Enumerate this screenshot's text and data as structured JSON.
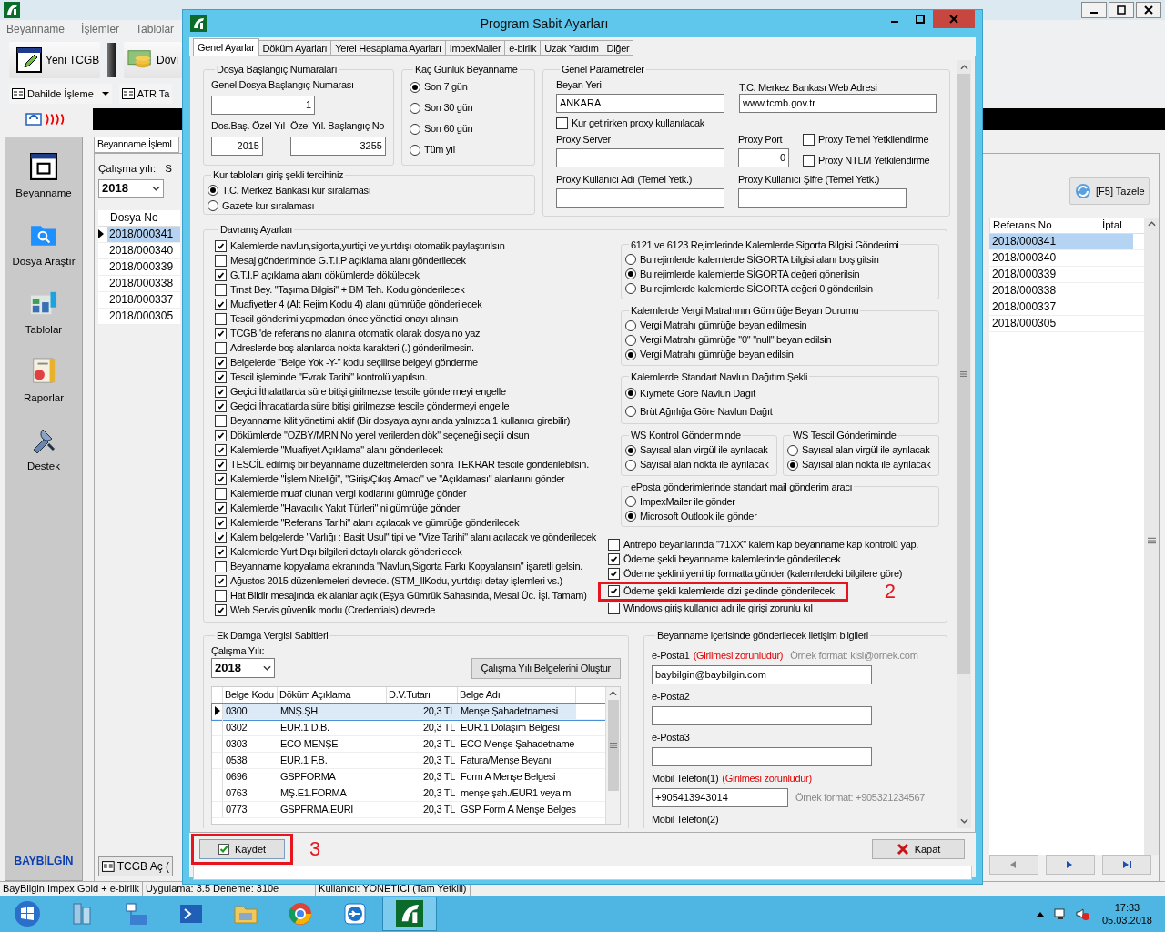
{
  "app": {
    "menu": [
      "Beyanname",
      "İşlemler",
      "Tablolar"
    ],
    "toolbar": [
      "Yeni TCGB",
      "Dövi"
    ],
    "toolbar2": [
      {
        "label": "Dahilde İşleme",
        "kind": "dropdown"
      },
      {
        "label": "ATR Ta",
        "kind": "plain"
      }
    ],
    "sidebar": [
      {
        "label": "Beyanname",
        "kind": "form"
      },
      {
        "label": "Dosya Araştır",
        "kind": "folder"
      },
      {
        "label": "Tablolar",
        "kind": "chart"
      },
      {
        "label": "Raporlar",
        "kind": "report"
      },
      {
        "label": "Destek",
        "kind": "tools"
      }
    ],
    "brand": "BAYBİLGİN",
    "tab": "Beyanname İşleml",
    "year_label": "Çalışma yılı:",
    "year_label_2": "S",
    "year": "2018",
    "grid": {
      "columns": [
        "Dosya No"
      ],
      "rows": [
        {
          "value": "2018/000341",
          "selected": true
        },
        {
          "value": "2018/000340",
          "selected": false
        },
        {
          "value": "2018/000339",
          "selected": false
        },
        {
          "value": "2018/000338",
          "selected": false
        },
        {
          "value": "2018/000337",
          "selected": false
        },
        {
          "value": "2018/000305",
          "selected": false
        }
      ]
    },
    "refresh_button": "[F5] Tazele",
    "right_grid": {
      "columns": [
        "Referans No",
        "İptal"
      ],
      "rows": [
        {
          "value": "2018/000341",
          "selected": true
        },
        {
          "value": "2018/000340",
          "selected": false
        },
        {
          "value": "2018/000339",
          "selected": false
        },
        {
          "value": "2018/000338",
          "selected": false
        },
        {
          "value": "2018/000337",
          "selected": false
        },
        {
          "value": "2018/000305",
          "selected": false
        }
      ]
    },
    "open_button": "TCGB Aç (",
    "status_bar": [
      "BayBilgin Impex Gold + e-birlik",
      "Uygulama: 3.5 Deneme: 310e",
      "Kullanıcı: YÖNETİCİ (Tam Yetkili)"
    ]
  },
  "dialog": {
    "title": "Program Sabit Ayarları",
    "tabs": [
      {
        "label": "Genel Ayarlar",
        "selected": true
      },
      {
        "label": "Döküm Ayarları",
        "selected": false
      },
      {
        "label": "Yerel Hesaplama Ayarları",
        "selected": false
      },
      {
        "label": "ImpexMailer",
        "selected": false
      },
      {
        "label": "e-birlik",
        "selected": false
      },
      {
        "label": "Uzak Yardım",
        "selected": false
      },
      {
        "label": "Diğer",
        "selected": false
      }
    ],
    "file_numbers": {
      "title": "Dosya Başlangıç Numaraları",
      "general_label": "Genel Dosya Başlangıç Numarası",
      "general_value": "1",
      "year_label": "Dos.Baş. Özel Yıl",
      "year_value": "2015",
      "start_label": "Özel Yıl. Başlangıç No",
      "start_value": "3255"
    },
    "days": {
      "title": "Kaç Günlük Beyanname",
      "options": [
        {
          "label": "Son 7 gün",
          "selected": true
        },
        {
          "label": "Son 30 gün",
          "selected": false
        },
        {
          "label": "Son 60 gün",
          "selected": false
        },
        {
          "label": "Tüm yıl",
          "selected": false
        }
      ]
    },
    "rate_table": {
      "title": "Kur tabloları giriş şekli tercihiniz",
      "options": [
        {
          "label": "T.C. Merkez Bankası kur sıralaması",
          "selected": true
        },
        {
          "label": "Gazete kur sıralaması",
          "selected": false
        }
      ]
    },
    "general": {
      "title": "Genel Parametreler",
      "place_label": "Beyan Yeri",
      "place_value": "ANKARA",
      "bank_label": "T.C. Merkez Bankası Web Adresi",
      "bank_value": "www.tcmb.gov.tr",
      "use_proxy": {
        "label": "Kur getirirken proxy kullanılacak",
        "checked": false
      },
      "server_label": "Proxy Server",
      "port_label": "Proxy Port",
      "port_value": "0",
      "auth": [
        {
          "label": "Proxy Temel Yetkilendirme",
          "checked": false
        },
        {
          "label": "Proxy NTLM Yetkilendirme",
          "checked": false
        }
      ],
      "user_label": "Proxy Kullanıcı Adı (Temel Yetk.)",
      "password_label": "Proxy Kullanıcı Şifre (Temel Yetk.)"
    },
    "behavior": {
      "title": "Davranış Ayarları",
      "options": [
        {
          "label": "Kalemlerde navlun,sigorta,yurtiçi ve yurtdışı otomatik paylaştırılsın",
          "checked": true
        },
        {
          "label": "Mesaj gönderiminde G.T.I.P açıklama alanı gönderilecek",
          "checked": false
        },
        {
          "label": "G.T.I.P açıklama alanı dökümlerde dökülecek",
          "checked": true
        },
        {
          "label": "Trnst Bey. \"Taşıma Bilgisi\" + BM Teh. Kodu gönderilecek",
          "checked": false
        },
        {
          "label": "Muafiyetler 4 (Alt Rejim Kodu 4) alanı gümrüğe gönderilecek",
          "checked": true
        },
        {
          "label": "Tescil gönderimi yapmadan önce yönetici onayı alınsın",
          "checked": false
        },
        {
          "label": "TCGB 'de referans no alanına otomatik olarak dosya no yaz",
          "checked": true
        },
        {
          "label": "Adreslerde boş alanlarda nokta karakteri (.) gönderilmesin.",
          "checked": false
        },
        {
          "label": "Belgelerde \"Belge Yok -Y-\" kodu seçilirse belgeyi gönderme",
          "checked": true
        },
        {
          "label": "Tescil işleminde \"Evrak Tarihi\" kontrolü yapılsın.",
          "checked": true
        },
        {
          "label": "Geçici İthalatlarda süre bitişi girilmezse tescile göndermeyi engelle",
          "checked": true
        },
        {
          "label": "Geçici İhracatlarda süre bitişi girilmezse tescile göndermeyi engelle",
          "checked": true
        },
        {
          "label": "Beyanname kilit yönetimi aktif (Bir dosyaya aynı anda yalnızca 1 kullanıcı girebilir)",
          "checked": false
        },
        {
          "label": "Dökümlerde \"ÖZBY/MRN No yerel verilerden dök\" seçeneği  seçili olsun",
          "checked": true
        },
        {
          "label": "Kalemlerde \"Muafiyet Açıklama\" alanı gönderilecek",
          "checked": true
        },
        {
          "label": "TESCİL edilmiş bir beyanname düzeltmelerden sonra TEKRAR tescile gönderilebilsin.",
          "checked": true
        },
        {
          "label": "Kalemlerde \"İşlem Niteliği\", \"Giriş/Çıkış Amacı\" ve \"Açıklaması\" alanlarını gönder",
          "checked": true
        },
        {
          "label": "Kalemlerde muaf olunan vergi kodlarını gümrüğe gönder",
          "checked": false
        },
        {
          "label": "Kalemlerde \"Havacılık Yakıt Türleri\" ni gümrüğe gönder",
          "checked": true
        },
        {
          "label": "Kalemlerde \"Referans Tarihi\" alanı açılacak ve gümrüğe gönderilecek",
          "checked": true
        },
        {
          "label": "Kalem belgelerde \"Varlığı : Basit Usul\" tipi ve \"Vize Tarihi\" alanı açılacak ve gönderilecek",
          "checked": true
        },
        {
          "label": "Kalemlerde Yurt Dışı bilgileri detaylı olarak gönderilecek",
          "checked": true
        },
        {
          "label": "Beyanname kopyalama ekranında \"Navlun,Sigorta Farkı Kopyalansın\" işaretli gelsin.",
          "checked": false
        },
        {
          "label": "Ağustos 2015 düzenlemeleri devrede. (STM_IlKodu, yurtdışı detay işlemleri vs.)",
          "checked": true
        },
        {
          "label": "Hat Bildir mesajında ek alanlar açık (Eşya Gümrük Sahasında, Mesai Üc. İşl. Tamam)",
          "checked": false
        },
        {
          "label": "Web Servis güvenlik modu (Credentials) devrede",
          "checked": true
        }
      ],
      "groups": [
        {
          "kind": "full",
          "title": "6121 ve 6123 Rejimlerinde Kalemlerde Sigorta Bilgisi Gönderimi",
          "options": [
            {
              "label": "Bu rejimlerde kalemlerde SİGORTA bilgisi alanı boş gitsin",
              "selected": false
            },
            {
              "label": "Bu rejimlerde kalemlerde SİGORTA değeri gönerilsin",
              "selected": true
            },
            {
              "label": "Bu rejimlerde kalemlerde SİGORTA değeri 0 gönderilsin",
              "selected": false
            }
          ]
        },
        {
          "kind": "full",
          "title": "Kalemlerde Vergi Matrahının Gümrüğe Beyan Durumu",
          "options": [
            {
              "label": "Vergi Matrahı gümrüğe beyan edilmesin",
              "selected": false
            },
            {
              "label": "Vergi Matrahı gümrüğe \"0\" \"null\" beyan edilsin",
              "selected": false
            },
            {
              "label": "Vergi Matrahı gümrüğe beyan edilsin",
              "selected": true
            }
          ]
        },
        {
          "kind": "full",
          "title": "Kalemlerde Standart Navlun Dağıtım Şekli",
          "options": [
            {
              "label": "Kıymete Göre Navlun Dağıt",
              "selected": true
            },
            {
              "label": "Brüt Ağırlığa Göre Navlun Dağıt",
              "selected": false
            }
          ]
        },
        {
          "kind": "half",
          "title": "WS Kontrol Gönderiminde",
          "options": [
            {
              "label": "Sayısal alan virgül ile ayrılacak",
              "selected": true
            },
            {
              "label": "Sayısal alan nokta ile ayrılacak",
              "selected": false
            }
          ]
        },
        {
          "kind": "half",
          "title": "WS Tescil Gönderiminde",
          "options": [
            {
              "label": "Sayısal alan virgül ile ayrılacak",
              "selected": false
            },
            {
              "label": "Sayısal alan nokta ile ayrılacak",
              "selected": true
            }
          ]
        },
        {
          "kind": "full",
          "title": "ePosta gönderimlerinde standart mail gönderim aracı",
          "options": [
            {
              "label": "ImpexMailer ile gönder",
              "selected": false
            },
            {
              "label": "Microsoft Outlook ile gönder",
              "selected": true
            }
          ]
        }
      ],
      "extra_options": [
        {
          "label": "Antrepo beyanlarında \"71XX\" kalem kap beyanname kap kontrolü yap.",
          "checked": false
        },
        {
          "label": "Ödeme şekli beyanname kalemlerinde gönderilecek",
          "checked": true
        },
        {
          "label": "Ödeme şeklini yeni tip formatta gönder (kalemlerdeki bilgilere göre)",
          "checked": true
        },
        {
          "label": "Ödeme şekli kalemlerde dizi şeklinde gönderilecek",
          "checked": true
        },
        {
          "label": "Windows giriş kullanıcı adı ile girişi zorunlu kıl",
          "checked": false
        }
      ]
    },
    "stamp_tax": {
      "title": "Ek Damga Vergisi Sabitleri",
      "year_label": "Çalışma Yılı:",
      "year": "2018",
      "button": "Çalışma Yılı Belgelerini Oluştur",
      "columns": [
        "Belge Kodu",
        "Döküm Açıklama",
        "D.V.Tutarı",
        "Belge Adı"
      ],
      "rows": [
        {
          "cells": [
            "0300",
            "MNŞ.ŞH.",
            "20,3 TL",
            "Menşe Şahadetnamesi"
          ],
          "selected": true
        },
        {
          "cells": [
            "0302",
            "EUR.1 D.B.",
            "20,3 TL",
            "EUR.1 Dolaşım Belgesi"
          ],
          "selected": false
        },
        {
          "cells": [
            "0303",
            "ECO MENŞE",
            "20,3 TL",
            "ECO Menşe Şahadetname"
          ],
          "selected": false
        },
        {
          "cells": [
            "0538",
            "EUR.1 F.B.",
            "20,3 TL",
            "Fatura/Menşe Beyanı"
          ],
          "selected": false
        },
        {
          "cells": [
            "0696",
            "GSPFORMA",
            "20,3 TL",
            "Form A Menşe Belgesi"
          ],
          "selected": false
        },
        {
          "cells": [
            "0763",
            "MŞ.E1.FORMA",
            "20,3 TL",
            "menşe şah./EUR1 veya m"
          ],
          "selected": false
        },
        {
          "cells": [
            "0773",
            "GSPFRMA.EURI",
            "20,3 TL",
            "GSP Form A Menşe Belges"
          ],
          "selected": false
        }
      ]
    },
    "contact": {
      "title": "Beyanname içerisinde gönderilecek iletişim bilgileri",
      "fields": [
        {
          "kind": "email",
          "label": "e-Posta1",
          "required": "(Girilmesi zorunludur)",
          "hint": "Örnek format: kisi@ornek.com",
          "value": "baybilgin@baybilgin.com"
        },
        {
          "kind": "plain",
          "label": "e-Posta2"
        },
        {
          "kind": "plain",
          "label": "e-Posta3"
        },
        {
          "kind": "phone",
          "label": "Mobil Telefon(1)",
          "required": "(Girilmesi zorunludur)",
          "hint": "Örnek format: +905321234567",
          "value": "+905413943014"
        },
        {
          "kind": "cut",
          "label": "Mobil Telefon(2)"
        }
      ]
    },
    "save_button": "Kaydet",
    "close_button": "Kapat"
  },
  "annotations": [
    {
      "label": "2"
    },
    {
      "label": "3"
    }
  ],
  "taskbar": {
    "time": "17:33",
    "date": "05.03.2018"
  }
}
